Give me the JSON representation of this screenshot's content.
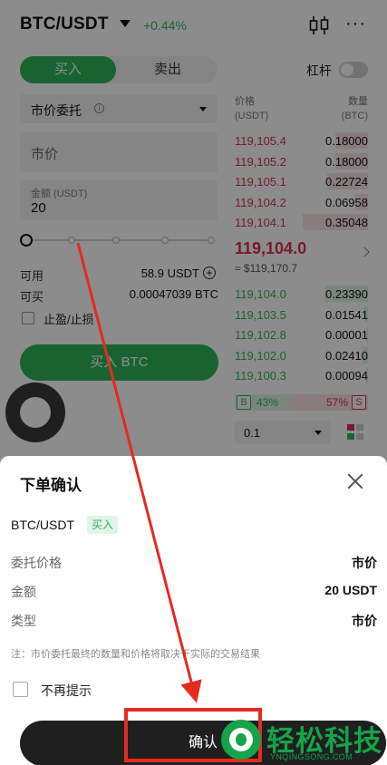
{
  "header": {
    "pair": "BTC/USDT",
    "change": "+0.44%",
    "candle_icon": "candlestick-chart-icon",
    "more_icon": "more-dots-icon",
    "more_text": "···"
  },
  "trade": {
    "buy_tab": "买入",
    "sell_tab": "卖出",
    "leverage_label": "杠杆",
    "leverage_on": false,
    "order_type": "市价委托",
    "info_icon": "info-icon",
    "info_glyph": "i",
    "price_field": "市价",
    "amount_label": "金额 (USDT)",
    "amount_value": "20",
    "slider_percent": 0,
    "available_label": "可用",
    "available_value": "58.9 USDT",
    "can_buy_label": "可买",
    "can_buy_value": "0.00047039 BTC",
    "plus_glyph": "+",
    "tpsl_label": "止盈/止损",
    "buy_button": "买入 BTC"
  },
  "orderbook": {
    "price_header": "价格\n(USDT)",
    "qty_header": "数量\n(BTC)",
    "asks": [
      {
        "price": "119,105.4",
        "qty": "0.18000",
        "depth": 0.5
      },
      {
        "price": "119,105.2",
        "qty": "0.18000",
        "depth": 0.5
      },
      {
        "price": "119,105.1",
        "qty": "0.22724",
        "depth": 0.62
      },
      {
        "price": "119,104.2",
        "qty": "0.06958",
        "depth": 0.2
      },
      {
        "price": "119,104.1",
        "qty": "0.35048",
        "depth": 1.0
      }
    ],
    "last_price": "119,104.0",
    "last_fiat": "≈ $119,170.7",
    "bids": [
      {
        "price": "119,104.0",
        "qty": "0.23390",
        "depth": 0.65
      },
      {
        "price": "119,103.5",
        "qty": "0.01541",
        "depth": 0.05
      },
      {
        "price": "119,102.8",
        "qty": "0.00001",
        "depth": 0.02
      },
      {
        "price": "119,102.0",
        "qty": "0.02410",
        "depth": 0.08
      },
      {
        "price": "119,100.3",
        "qty": "0.00094",
        "depth": 0.03
      }
    ],
    "buy_ratio_badge": "B",
    "buy_ratio": "43%",
    "buy_ratio_value": 0.43,
    "sell_ratio_badge": "S",
    "sell_ratio": "57%",
    "sell_ratio_value": 0.57,
    "precision": "0.1",
    "layout_icon": "orderbook-layout-icon"
  },
  "confirm_sheet": {
    "title": "下单确认",
    "close_icon": "close-icon",
    "pair": "BTC/USDT",
    "side_badge": "买入",
    "rows": [
      {
        "label": "委托价格",
        "value": "市价"
      },
      {
        "label": "金额",
        "value": "20 USDT"
      },
      {
        "label": "类型",
        "value": "市价"
      }
    ],
    "note": "注：市价委托最终的数量和价格将取决于实际的交易结果",
    "no_more_label": "不再提示",
    "confirm_button": "确认"
  },
  "watermark": {
    "title": "轻松科技",
    "subtitle": "YNQINGSONG.COM"
  },
  "colors": {
    "buy_green": "#2fb45a",
    "sell_red": "#d9304f",
    "annotation_red": "#e32b22",
    "watermark_green": "#16a34a",
    "confirm_dark": "#1f1f1f"
  }
}
